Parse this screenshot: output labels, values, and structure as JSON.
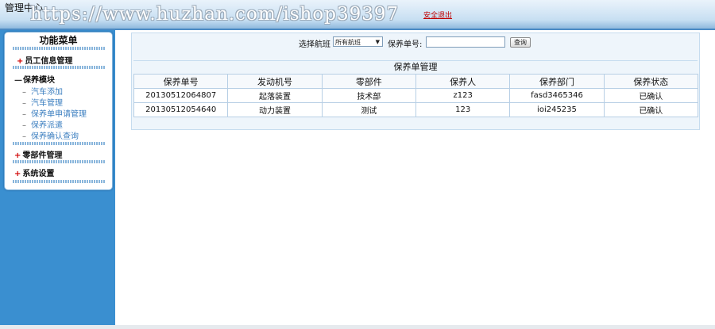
{
  "header": {
    "title": "管理中心",
    "watermark": "https://www.huzhan.com/ishop39397",
    "logout_label": "安全退出"
  },
  "sidebar": {
    "menu_title": "功能菜单",
    "groups": [
      {
        "label": "员工信息管理",
        "state": "collapsed",
        "items": []
      },
      {
        "label": "保养模块",
        "state": "expanded",
        "items": [
          {
            "label": "汽车添加"
          },
          {
            "label": "汽车管理"
          },
          {
            "label": "保养单申请管理"
          },
          {
            "label": "保养派遣"
          },
          {
            "label": "保养确认查询"
          }
        ]
      },
      {
        "label": "零部件管理",
        "state": "collapsed",
        "items": []
      },
      {
        "label": "系统设置",
        "state": "collapsed",
        "items": []
      }
    ]
  },
  "search": {
    "route_label": "选择航班",
    "route_selected": "所有航班",
    "order_label": "保养单号:",
    "order_value": "",
    "query_button": "查询"
  },
  "table": {
    "title": "保养单管理",
    "columns": [
      "保养单号",
      "发动机号",
      "零部件",
      "保养人",
      "保养部门",
      "保养状态"
    ],
    "rows": [
      [
        "20130512064807",
        "起落装置",
        "技术部",
        "z123",
        "fasd3465346",
        "已确认"
      ],
      [
        "20130512054640",
        "动力装置",
        "测试",
        "123",
        "ioi245235",
        "已确认"
      ]
    ]
  },
  "colors": {
    "sidebar_bg": "#3a8fd0",
    "header_border": "#4a8ac4",
    "logout_red": "#c00000",
    "link_blue": "#3c7fc0"
  }
}
